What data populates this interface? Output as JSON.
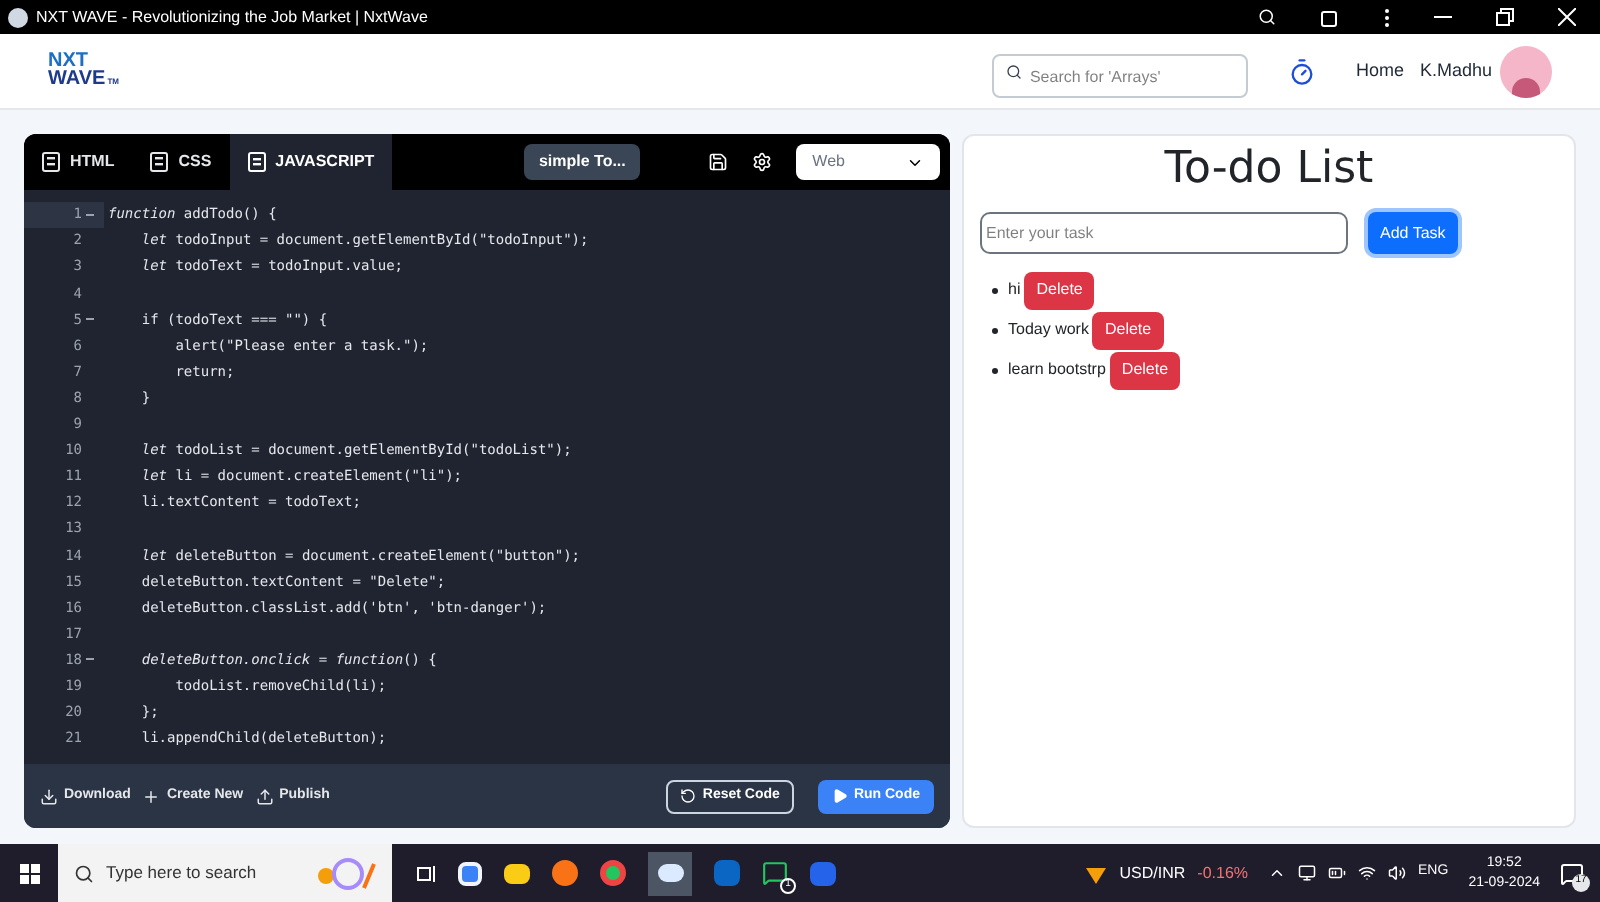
{
  "window": {
    "title": "NXT WAVE - Revolutionizing the Job Market | NxtWave"
  },
  "header": {
    "logo": {
      "line_1": "NXT",
      "line_2": "WAVE",
      "mark": "TM"
    },
    "search": {
      "placeholder": "Search for 'Arrays'"
    },
    "nav": [
      {
        "label": "Home"
      }
    ],
    "user": {
      "name": "K.Madhu"
    }
  },
  "editor": {
    "tabs": [
      {
        "label": "HTML",
        "selected": false
      },
      {
        "label": "CSS",
        "selected": false
      },
      {
        "label": "JAVASCRIPT",
        "selected": true
      }
    ],
    "project_name": "simple To...",
    "mode": {
      "value": "Web"
    },
    "lines": [
      {
        "number": "1",
        "fold": true,
        "active": true,
        "code": "*function* addTodo() {"
      },
      {
        "number": "2",
        "fold": false,
        "active": false,
        "code": "    *let* todoInput = document.getElementById(\"todoInput\");"
      },
      {
        "number": "3",
        "fold": false,
        "active": false,
        "code": "    *let* todoText = todoInput.value;"
      },
      {
        "number": "4",
        "fold": false,
        "active": false
      },
      {
        "number": "5",
        "fold": true,
        "active": false,
        "code": "    if (todoText === \"\") {"
      },
      {
        "number": "6",
        "fold": false,
        "active": false,
        "code": "        alert(\"Please enter a task.\");"
      },
      {
        "number": "7",
        "fold": false,
        "active": false,
        "code": "        return;"
      },
      {
        "number": "8",
        "fold": false,
        "active": false,
        "code": "    }"
      },
      {
        "number": "9",
        "fold": false,
        "active": false
      },
      {
        "number": "10",
        "fold": false,
        "active": false,
        "code": "    *let* todoList = document.getElementById(\"todoList\");"
      },
      {
        "number": "11",
        "fold": false,
        "active": false,
        "code": "    *let* li = document.createElement(\"li\");"
      },
      {
        "number": "12",
        "fold": false,
        "active": false,
        "code": "    li.textContent = todoText;"
      },
      {
        "number": "13",
        "fold": false,
        "active": false
      },
      {
        "number": "14",
        "fold": false,
        "active": false,
        "code": "    *let* deleteButton = document.createElement(\"button\");"
      },
      {
        "number": "15",
        "fold": false,
        "active": false,
        "code": "    deleteButton.textContent = \"Delete\";"
      },
      {
        "number": "16",
        "fold": false,
        "active": false,
        "code": "    deleteButton.classList.add('btn', 'btn-danger');"
      },
      {
        "number": "17",
        "fold": false,
        "active": false
      },
      {
        "number": "18",
        "fold": true,
        "active": false,
        "code": "    *deleteButton.onclick* = *function*() {"
      },
      {
        "number": "19",
        "fold": false,
        "active": false,
        "code": "        todoList.removeChild(li);"
      },
      {
        "number": "20",
        "fold": false,
        "active": false,
        "code": "    };"
      },
      {
        "number": "21",
        "fold": false,
        "active": false,
        "code": "    li.appendChild(deleteButton);"
      }
    ],
    "footer_actions": [
      {
        "label": "Download",
        "kind": "download"
      },
      {
        "label": "Create New",
        "kind": "create"
      },
      {
        "label": "Publish",
        "kind": "publish"
      }
    ],
    "reset_button": "Reset Code",
    "run_button": "Run Code"
  },
  "preview": {
    "title": "To-do List",
    "input": {
      "placeholder": "Enter your task"
    },
    "add_button": "Add Task",
    "items": [
      {
        "text": "hi",
        "button": "Delete"
      },
      {
        "text": "Today work",
        "button": "Delete"
      },
      {
        "text": "learn bootstrp",
        "button": "Delete"
      }
    ]
  },
  "taskbar": {
    "search": {
      "placeholder": "Type here to search"
    },
    "whatsapp_badge": "1",
    "ticker": {
      "symbol": "USD/INR",
      "change": "-0.16%"
    },
    "language": "ENG",
    "time": "19:52",
    "date": "21-09-2024",
    "notifications": "17"
  }
}
